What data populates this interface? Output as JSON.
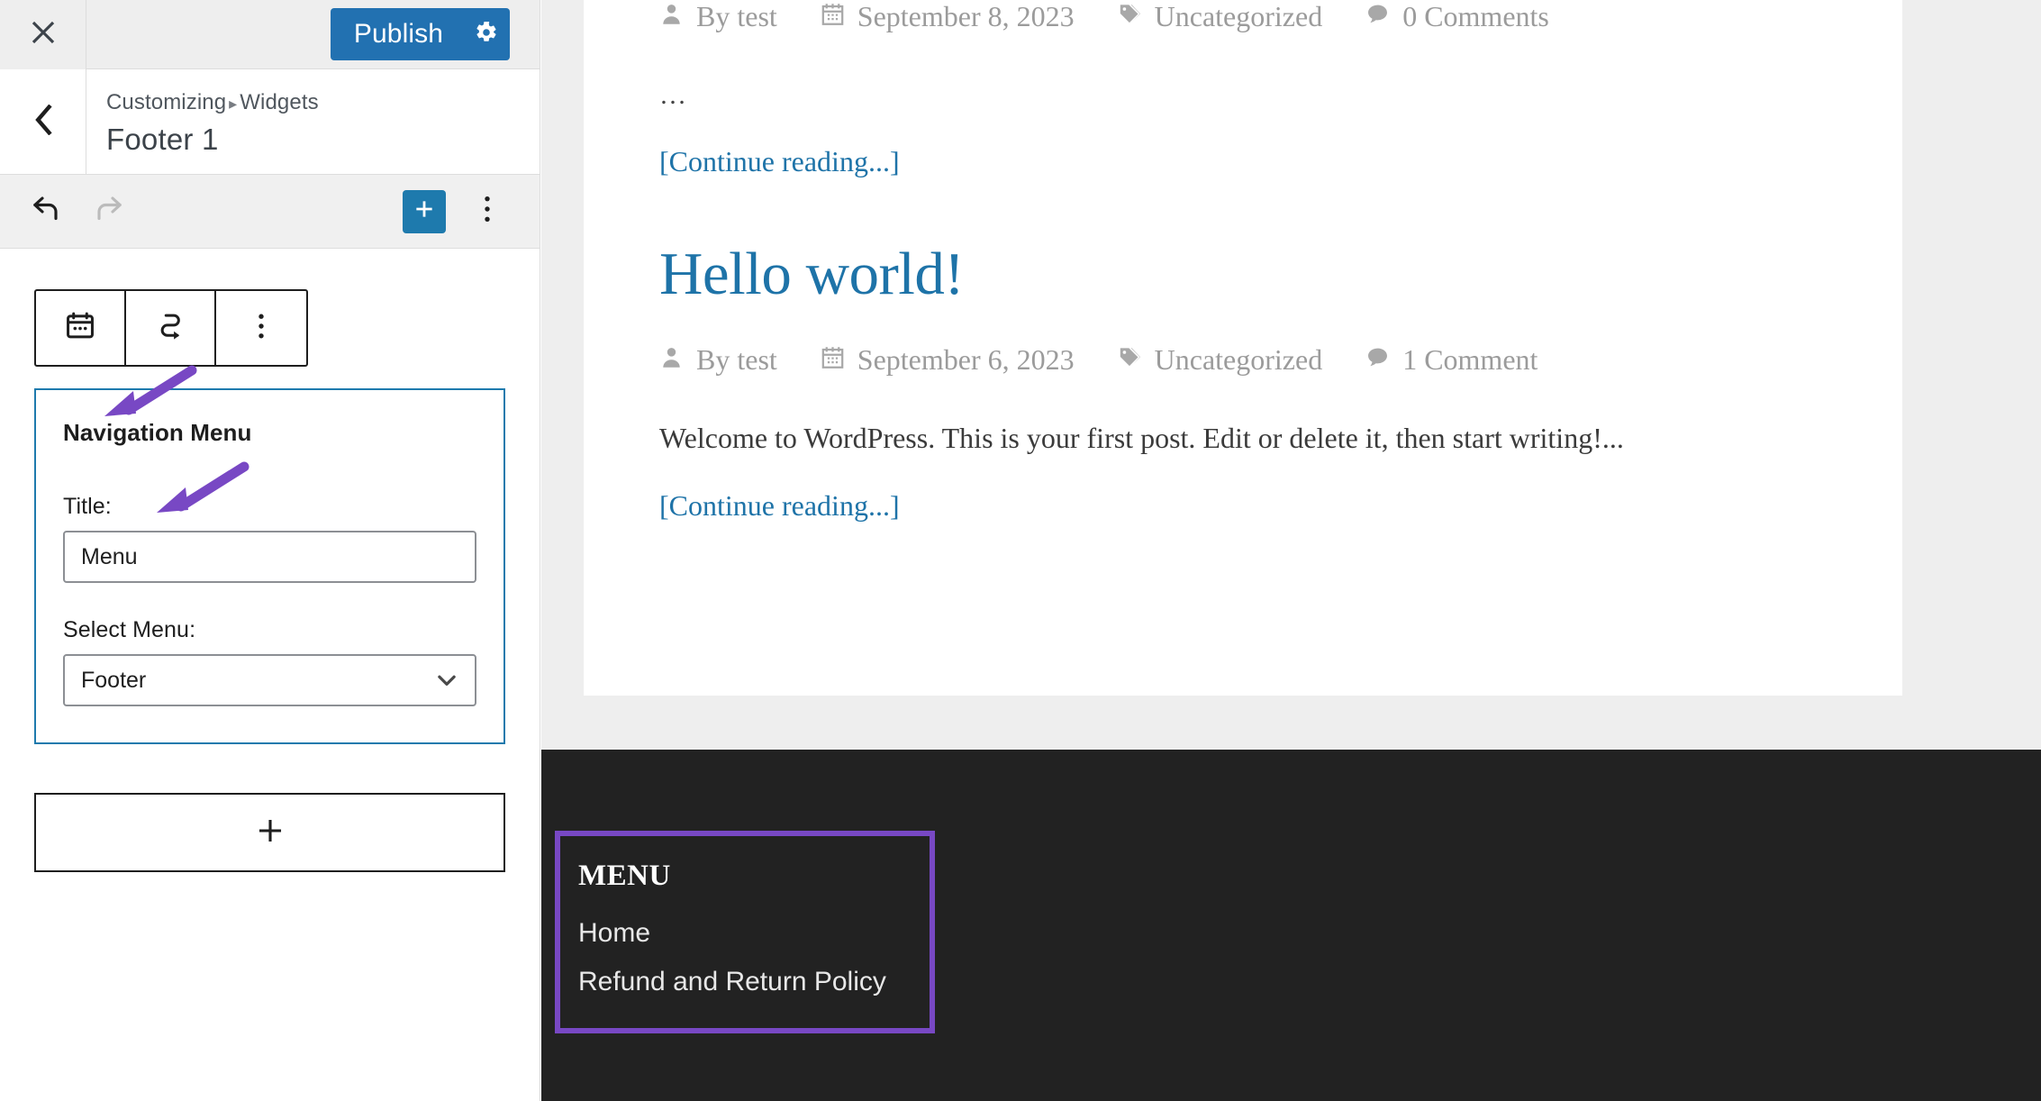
{
  "sidebar": {
    "close_icon": "close-icon",
    "publish_label": "Publish",
    "publish_settings_icon": "gear-icon",
    "back_icon": "chevron-left-icon",
    "breadcrumb_root": "Customizing",
    "breadcrumb_separator": "▸",
    "breadcrumb_section": "Widgets",
    "panel_title": "Footer 1",
    "toolbar": {
      "undo_icon": "undo-icon",
      "redo_icon": "redo-icon",
      "add_block_icon": "plus-icon",
      "more_options_icon": "vertical-ellipsis-icon"
    },
    "block_toolbar": {
      "block_type_icon": "calendar-widget-icon",
      "move_to_icon": "move-to-arrow-icon",
      "more_icon": "vertical-ellipsis-icon"
    },
    "widget": {
      "name": "Navigation Menu",
      "title_label": "Title:",
      "title_value": "Menu",
      "title_placeholder": "",
      "select_label": "Select Menu:",
      "select_value": "Footer",
      "select_chevron_icon": "chevron-down-icon",
      "select_options": [
        "Footer"
      ]
    },
    "add_widget_icon": "plus-icon",
    "annotation_color": "#7848c4"
  },
  "preview": {
    "posts": [
      {
        "title": "",
        "author": "By test",
        "date": "September 8, 2023",
        "category": "Uncategorized",
        "comments": "0 Comments",
        "excerpt": "…",
        "continue_label": "[Continue reading...]"
      },
      {
        "title": "Hello world!",
        "author": "By test",
        "date": "September 6, 2023",
        "category": "Uncategorized",
        "comments": "1 Comment",
        "excerpt": "Welcome to WordPress. This is your first post. Edit or delete it, then start writing!...",
        "continue_label": "[Continue reading...]"
      }
    ],
    "meta_icons": {
      "author": "user-icon",
      "date": "calendar-icon",
      "category": "tag-icon",
      "comments": "comment-icon"
    },
    "footer": {
      "widget_title": "MENU",
      "menu_items": [
        "Home",
        "Refund and Return Policy"
      ],
      "highlight_color": "#7848c4",
      "background": "#222222"
    },
    "link_color": "#1e73a8"
  }
}
